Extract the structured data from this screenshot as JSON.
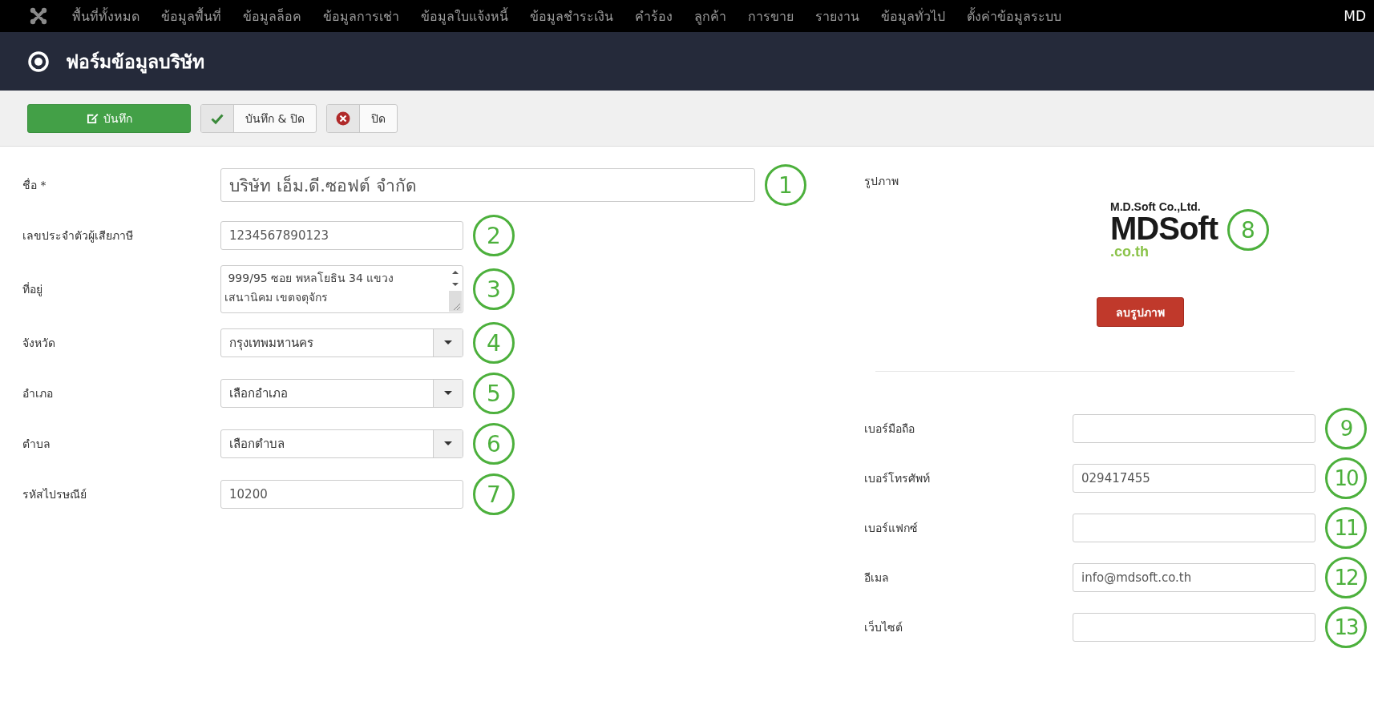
{
  "nav": {
    "items": [
      "พื้นที่ทั้งหมด",
      "ข้อมูลพื้นที่",
      "ข้อมูลล็อค",
      "ข้อมูลการเช่า",
      "ข้อมูลใบแจ้งหนี้",
      "ข้อมูลชำระเงิน",
      "คำร้อง",
      "ลูกค้า",
      "การขาย",
      "รายงาน",
      "ข้อมูลทั่วไป",
      "ตั้งค่าข้อมูลระบบ"
    ],
    "user": "MD"
  },
  "header": {
    "title": "ฟอร์มข้อมูลบริษัท"
  },
  "toolbar": {
    "buttons": [
      {
        "label": "บันทึก",
        "kind": "primary"
      },
      {
        "label": "บันทึก & ปิด",
        "kind": "check"
      },
      {
        "label": "ปิด",
        "kind": "close"
      }
    ]
  },
  "left_fields": [
    {
      "label": "ชื่อ *",
      "kind": "large-text",
      "value": "บริษัท เอ็ม.ดี.ซอฟต์ จำกัด",
      "annotation": "1"
    },
    {
      "label": "เลขประจำตัวผู้เสียภาษี",
      "kind": "text",
      "value": "1234567890123",
      "annotation": "2"
    },
    {
      "label": "ที่อยู่",
      "kind": "textarea",
      "value": " 999/95 ซอย พหลโยธิน 34 แขวง\nเสนานิคม เขตจตุจักร",
      "annotation": "3"
    },
    {
      "label": "จังหวัด",
      "kind": "select",
      "value": "กรุงเทพมหานคร",
      "annotation": "4"
    },
    {
      "label": "อำเภอ",
      "kind": "select",
      "value": "เลือกอำเภอ",
      "annotation": "5"
    },
    {
      "label": "ตำบล",
      "kind": "select",
      "value": "เลือกตำบล",
      "annotation": "6"
    },
    {
      "label": "รหัสไปรษณีย์",
      "kind": "text",
      "value": "10200",
      "annotation": "7"
    }
  ],
  "image_panel": {
    "label": "รูปภาพ",
    "logo": {
      "company": "M.D.Soft Co.,Ltd.",
      "name": "MDSoft",
      "domain": ".co.th"
    },
    "annotation": "8",
    "delete_button": "ลบรูปภาพ"
  },
  "right_fields": [
    {
      "label": "เบอร์มือถือ",
      "kind": "text",
      "annotation": "9"
    },
    {
      "label": "เบอร์โทรศัพท์",
      "kind": "text",
      "value": "029417455",
      "annotation": "10"
    },
    {
      "label": "เบอร์แฟกซ์",
      "kind": "text",
      "annotation": "11"
    },
    {
      "label": "อีเมล",
      "kind": "text",
      "value": "info@mdsoft.co.th",
      "annotation": "12"
    },
    {
      "label": "เว็บไซต์",
      "kind": "text",
      "annotation": "13"
    }
  ]
}
